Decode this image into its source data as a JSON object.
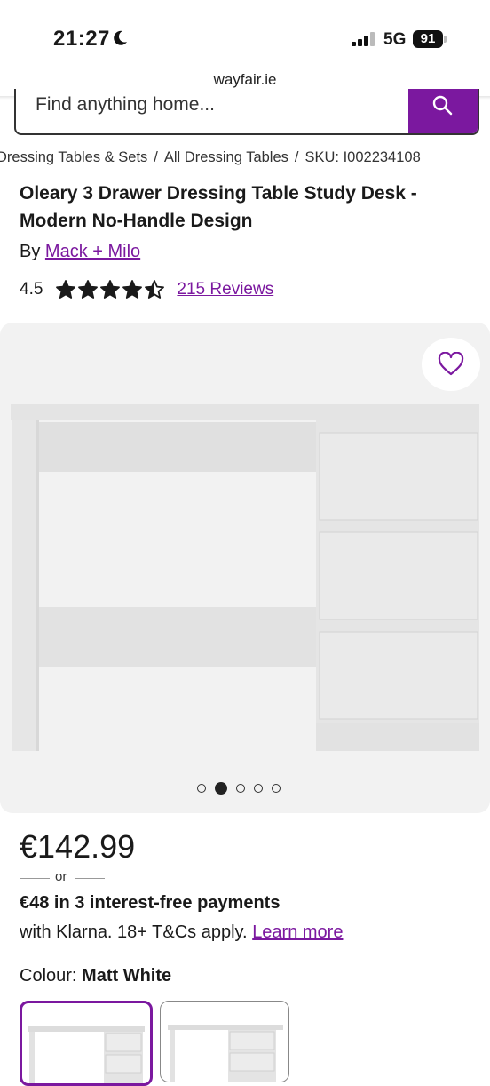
{
  "status_bar": {
    "time": "21:27",
    "network": "5G",
    "battery": "91"
  },
  "browser": {
    "url": "wayfair.ie"
  },
  "search": {
    "placeholder": "Find anything home..."
  },
  "breadcrumb": {
    "items": [
      "Dressing Tables & Sets",
      "All Dressing Tables"
    ],
    "separator": "/",
    "sku": "SKU: I002234108"
  },
  "product": {
    "title": "Oleary 3 Drawer Dressing Table Study Desk - Modern No-Handle Design",
    "by_label": "By",
    "brand": "Mack + Milo",
    "rating": "4.5",
    "rating_value": 4.5,
    "rating_max": 5,
    "reviews": "215 Reviews"
  },
  "gallery": {
    "image_count": 5,
    "active_index": 1
  },
  "pricing": {
    "price": "€142.99",
    "or": "or",
    "klarna_bold": "€48 in 3 interest-free payments",
    "klarna_text": "with Klarna. 18+ T&Cs apply.",
    "learn_more": "Learn more"
  },
  "options": {
    "colour_label": "Colour:",
    "colour_value": "Matt White"
  },
  "colors": {
    "accent": "#7b189f",
    "text": "#1a1a1a",
    "gallery_bg": "#f2f2f2"
  }
}
